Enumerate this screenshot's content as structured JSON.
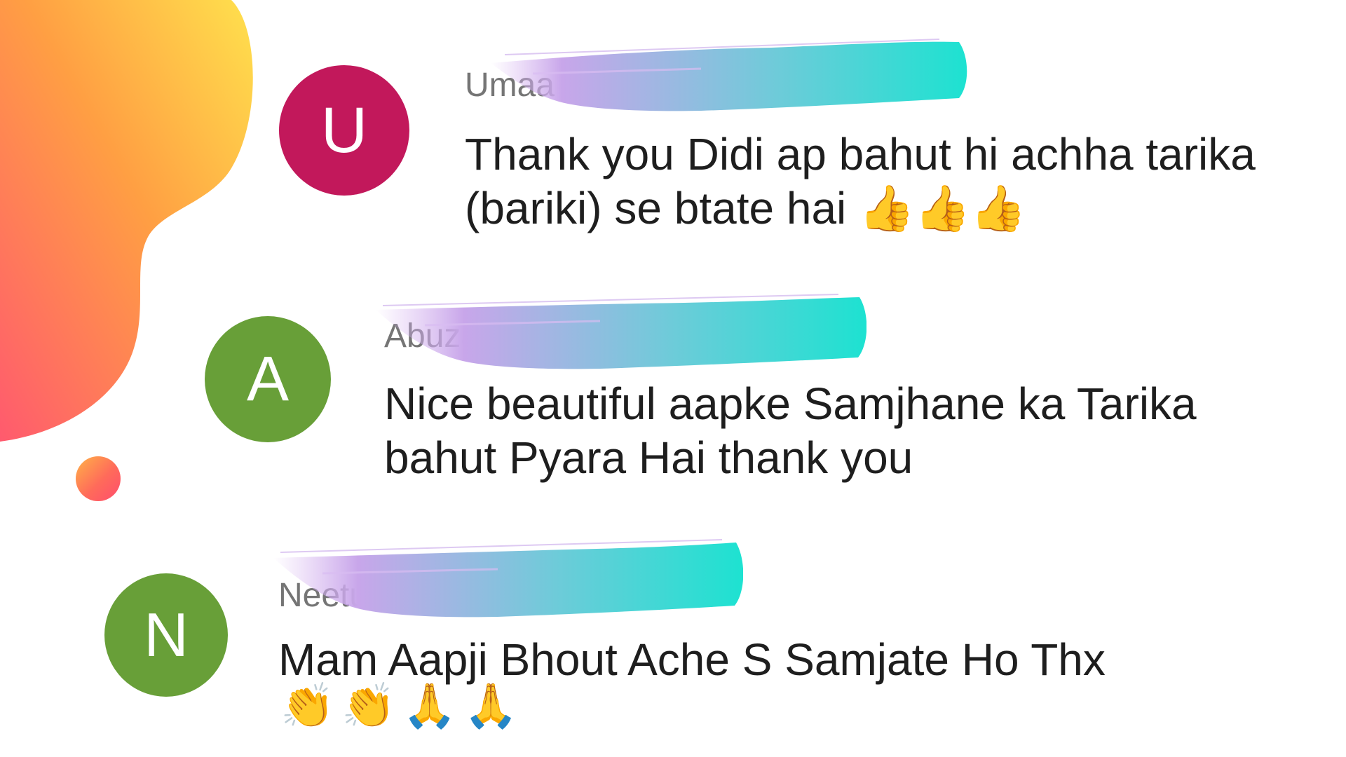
{
  "comments": [
    {
      "avatar_letter": "U",
      "avatar_color": "#c2185b",
      "author_visible": "Umaa Ch",
      "text": "Thank you Didi ap bahut hi achha tarika\n(bariki) se btate hai",
      "emoji": [
        "👍",
        "👍",
        "👍"
      ]
    },
    {
      "avatar_letter": "A",
      "avatar_color": "#689f38",
      "author_visible": "Abuza",
      "text": "Nice beautiful aapke Samjhane ka Tarika\nbahut Pyara Hai thank you"
    },
    {
      "avatar_letter": "N",
      "avatar_color": "#689f38",
      "author_visible": "Neetu",
      "text": "Mam Aapji Bhout Ache S Samjate Ho Thx",
      "emoji": [
        "👏",
        "👏",
        "🙏",
        "🙏"
      ]
    }
  ],
  "colors": {
    "blob_start": "#ffd54f",
    "blob_end": "#ff5a6e",
    "redaction_start": "#c8a6ea",
    "redaction_end": "#1de2d1"
  }
}
